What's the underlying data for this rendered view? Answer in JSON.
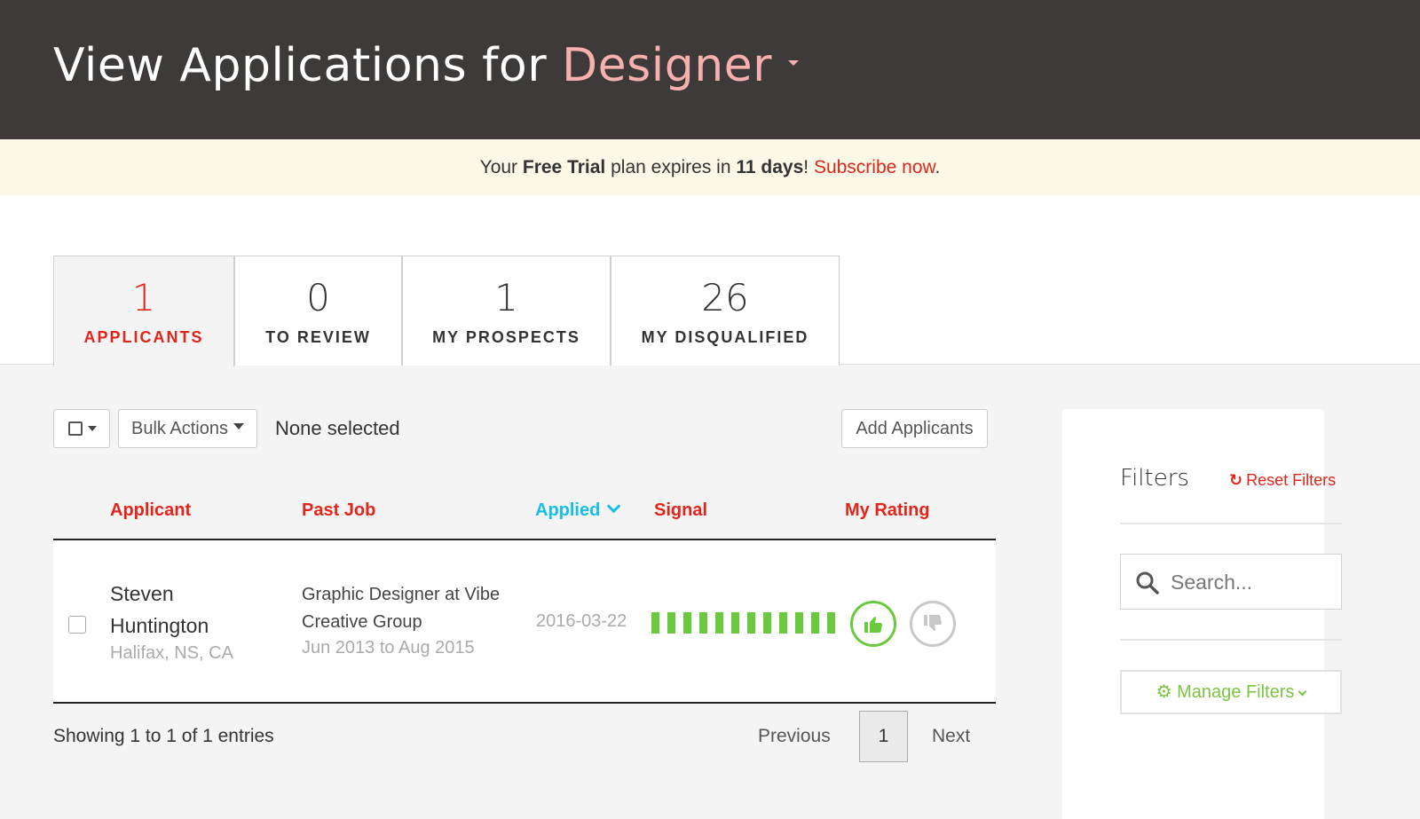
{
  "header": {
    "title_prefix": "View Applications for",
    "job_name": "Designer",
    "job_color": "#f6b0ae"
  },
  "trial_banner": {
    "part1": "Your ",
    "plan": "Free Trial",
    "part2": " plan expires in ",
    "days": "11 days",
    "part3": "! ",
    "link": "Subscribe now",
    "part4": "."
  },
  "tabs": [
    {
      "count": "1",
      "label": "APPLICANTS",
      "active": true
    },
    {
      "count": "0",
      "label": "TO REVIEW",
      "active": false
    },
    {
      "count": "1",
      "label": "MY PROSPECTS",
      "active": false
    },
    {
      "count": "26",
      "label": "MY DISQUALIFIED",
      "active": false
    }
  ],
  "toolbar": {
    "bulk_actions": "Bulk Actions",
    "selection_status": "None selected",
    "add_applicants": "Add Applicants"
  },
  "table": {
    "columns": [
      "Applicant",
      "Past Job",
      "Applied",
      "Signal",
      "My Rating"
    ],
    "sorted_column": "Applied",
    "rows": [
      {
        "name": "Steven Huntington",
        "location": "Halifax, NS, CA",
        "past_job": "Graphic Designer at Vibe Creative Group",
        "past_job_dates": "Jun 2013 to Aug 2015",
        "applied": "2016-03-22",
        "signal_bars": 12,
        "rating": "thumbs-up"
      }
    ]
  },
  "pagination": {
    "summary": "Showing 1 to 1 of 1 entries",
    "previous": "Previous",
    "current_page": "1",
    "next": "Next"
  },
  "filters": {
    "title": "Filters",
    "reset": "Reset Filters",
    "search_placeholder": "Search...",
    "manage": "Manage Filters"
  },
  "colors": {
    "accent_red": "#e1251b",
    "sort_blue": "#16bfe6",
    "signal_green": "#6ac93f",
    "header_bg": "#3d3a39",
    "banner_bg": "#fcf8e7"
  }
}
